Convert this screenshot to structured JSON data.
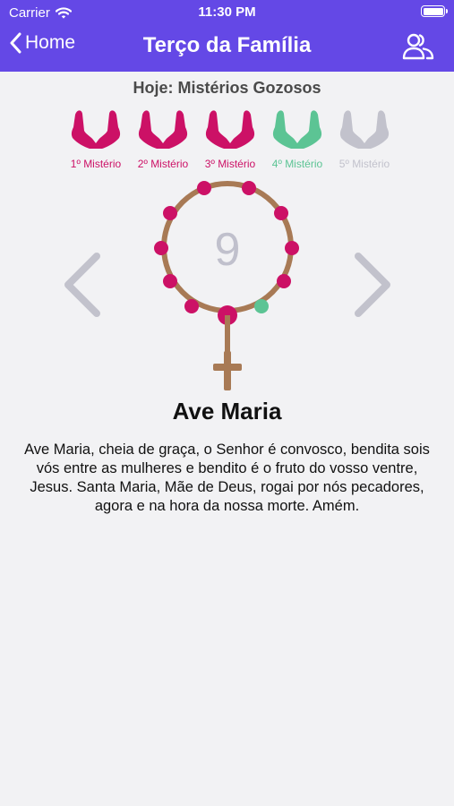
{
  "status_bar": {
    "carrier": "Carrier",
    "time": "11:30 PM"
  },
  "nav": {
    "back_label": "Home",
    "title": "Terço da Família",
    "right_icon": "people-icon"
  },
  "today": "Hoje: Mistérios Gozosos",
  "mysteries": [
    {
      "label": "1º Mistério",
      "color": "#cc1166",
      "state": "done"
    },
    {
      "label": "2º Mistério",
      "color": "#cc1166",
      "state": "done"
    },
    {
      "label": "3º Mistério",
      "color": "#cc1166",
      "state": "done"
    },
    {
      "label": "4º Mistério",
      "color": "#5cc494",
      "state": "current"
    },
    {
      "label": "5º Mistério",
      "color": "#c2c2cc",
      "state": "upcoming"
    }
  ],
  "rosary": {
    "count": "9",
    "current_bead": 9,
    "colors": {
      "cord": "#a87a55",
      "bead": "#cc1166",
      "current_bead": "#5cc494",
      "count": "#c0c0cc"
    }
  },
  "prayer": {
    "title": "Ave Maria",
    "text": "Ave Maria, cheia de graça, o Senhor é convosco, bendita sois vós entre as mulheres e bendito é o fruto do vosso ventre, Jesus. Santa Maria, Mãe de Deus, rogai por nós pecadores, agora e na hora da nossa morte. Amém."
  },
  "colors": {
    "header": "#6448e6",
    "arrow": "#c2c2cc"
  }
}
